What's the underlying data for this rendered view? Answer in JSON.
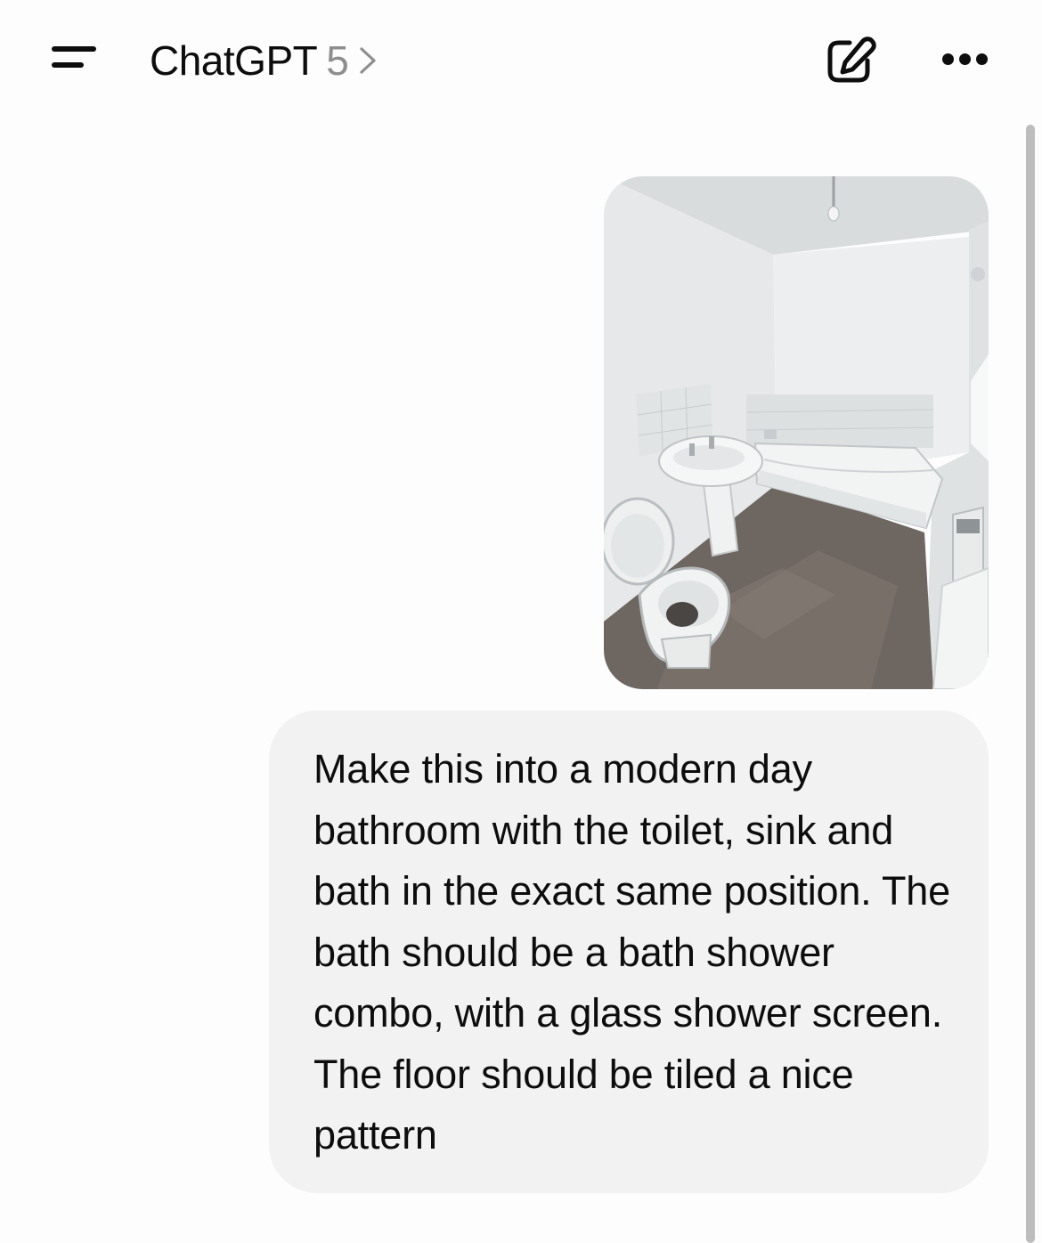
{
  "header": {
    "title": "ChatGPT",
    "model_version": "5",
    "icons": {
      "menu": "sidebar-menu-icon",
      "chevron": "chevron-right-icon",
      "new_chat": "new-chat-edit-icon",
      "more": "more-options-icon"
    }
  },
  "conversation": {
    "user_message": {
      "attachment": {
        "type": "image",
        "subject": "bathroom-photo"
      },
      "text": "Make this into a modern day bathroom with the toilet, sink and bath in the exact same position. The bath should be a bath shower combo, with a glass shower screen. The floor should be tiled a nice pattern"
    }
  },
  "colors": {
    "background": "#fdfdfd",
    "bubble": "#f2f2f2",
    "text": "#0d0d0d",
    "muted": "#8e8e8e",
    "scrollbar": "#bdbdbd"
  }
}
